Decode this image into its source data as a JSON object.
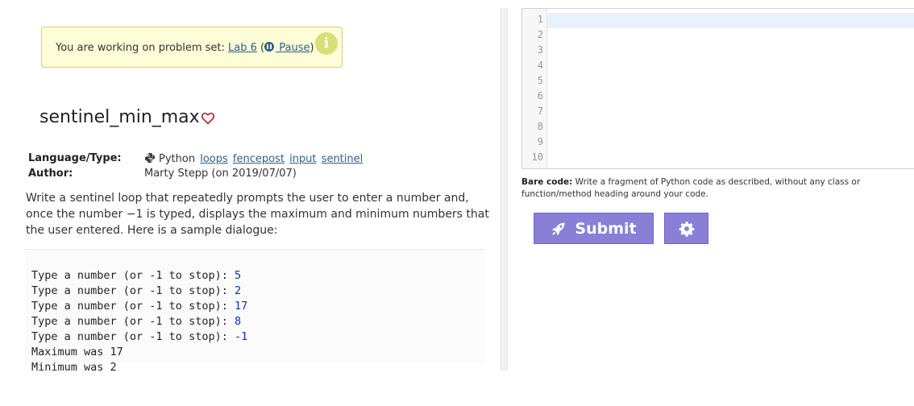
{
  "banner": {
    "prefix": "You are working on problem set: ",
    "problem_set_link": "Lab 6",
    "open_paren": " (",
    "pause_label": " Pause",
    "close_paren": ")",
    "info_glyph": "i"
  },
  "problem": {
    "title": "sentinel_min_max",
    "language_label": "Language/Type:",
    "language": "Python",
    "tags": [
      "loops",
      "fencepost",
      "input",
      "sentinel"
    ],
    "author_label": "Author:",
    "author": "Marty Stepp (on 2019/07/07)",
    "description": "Write a sentinel loop that repeatedly prompts the user to enter a number and, once the number −1 is typed, displays the maximum and minimum numbers that the user entered. Here is a sample dialogue:"
  },
  "sample_dialogue": [
    {
      "prompt": "Type a number (or -1 to stop): ",
      "input": "5"
    },
    {
      "prompt": "Type a number (or -1 to stop): ",
      "input": "2"
    },
    {
      "prompt": "Type a number (or -1 to stop): ",
      "input": "17"
    },
    {
      "prompt": "Type a number (or -1 to stop): ",
      "input": "8"
    },
    {
      "prompt": "Type a number (or -1 to stop): ",
      "input": "-1"
    },
    {
      "prompt": "Maximum was 17",
      "input": ""
    },
    {
      "prompt": "Minimum was 2",
      "input": ""
    }
  ],
  "editor": {
    "line_numbers": [
      "1",
      "2",
      "3",
      "4",
      "5",
      "6",
      "7",
      "8",
      "9",
      "10"
    ]
  },
  "bare_code": {
    "label": "Bare code:",
    "text": " Write a fragment of Python code as described, without any class or function/method heading around your code."
  },
  "buttons": {
    "submit_label": "Submit"
  },
  "colors": {
    "button": "#8a7fd6",
    "link": "#2f5f88",
    "banner_bg": "#fdfdd8",
    "heart": "#b03040",
    "user_input": "#0033cc"
  }
}
